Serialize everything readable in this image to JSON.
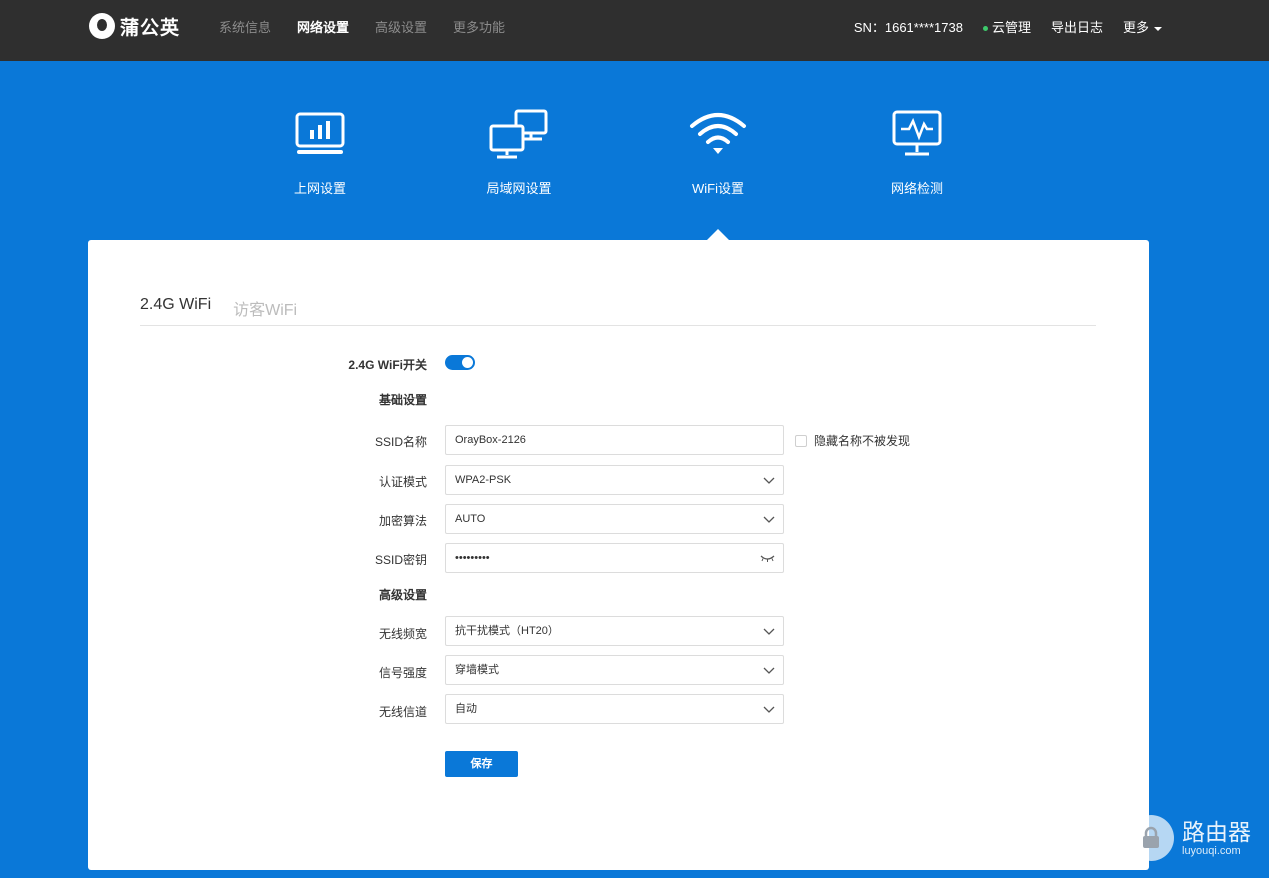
{
  "brand": {
    "name": "蒲公英"
  },
  "topnav": [
    "系统信息",
    "网络设置",
    "高级设置",
    "更多功能"
  ],
  "header": {
    "sn": "SN：1661****1738",
    "cloud": "云管理",
    "export": "导出日志",
    "more": "更多"
  },
  "categories": [
    {
      "label": "上网设置",
      "icon": "monitor-chart-icon"
    },
    {
      "label": "局域网设置",
      "icon": "lan-computers-icon"
    },
    {
      "label": "WiFi设置",
      "icon": "wifi-icon"
    },
    {
      "label": "网络检测",
      "icon": "monitor-pulse-icon"
    }
  ],
  "tabs": [
    "2.4G WiFi",
    "访客WiFi"
  ],
  "form": {
    "wifi_switch_label": "2.4G WiFi开关",
    "basic_title": "基础设置",
    "ssid_label": "SSID名称",
    "ssid_value": "OrayBox-2126",
    "hide_label": "隐藏名称不被发现",
    "auth_label": "认证模式",
    "auth_value": "WPA2-PSK",
    "enc_label": "加密算法",
    "enc_value": "AUTO",
    "key_label": "SSID密钥",
    "key_value": "•••••••••",
    "adv_title": "高级设置",
    "bw_label": "无线频宽",
    "bw_value": "抗干扰模式（HT20）",
    "power_label": "信号强度",
    "power_value": "穿墙模式",
    "channel_label": "无线信道",
    "channel_value": "自动",
    "save": "保存"
  },
  "watermark": {
    "text": "路由器",
    "site": "luyouqi.com"
  }
}
